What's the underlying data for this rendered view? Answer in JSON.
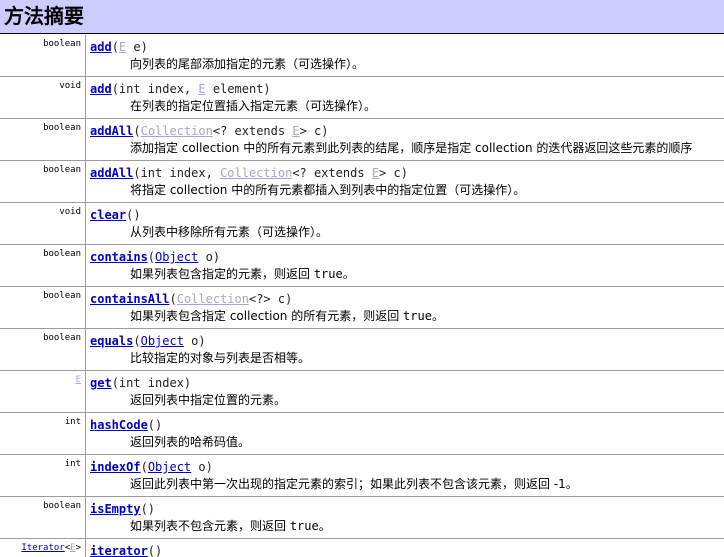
{
  "header": {
    "title": "方法摘要"
  },
  "rows": [
    {
      "ret": "boolean",
      "method": "add",
      "params": [
        {
          "text": "(",
          "kind": "plain"
        },
        {
          "text": "E",
          "kind": "type"
        },
        {
          "text": " e)",
          "kind": "plain"
        }
      ],
      "desc": "向列表的尾部添加指定的元素（可选操作）。"
    },
    {
      "ret": "void",
      "method": "add",
      "params": [
        {
          "text": "(int index, ",
          "kind": "plain"
        },
        {
          "text": "E",
          "kind": "type"
        },
        {
          "text": " element)",
          "kind": "plain"
        }
      ],
      "desc": "在列表的指定位置插入指定元素（可选操作）。"
    },
    {
      "ret": "boolean",
      "method": "addAll",
      "params": [
        {
          "text": "(",
          "kind": "plain"
        },
        {
          "text": "Collection",
          "kind": "type"
        },
        {
          "text": "<? extends ",
          "kind": "plain"
        },
        {
          "text": "E",
          "kind": "type"
        },
        {
          "text": "> c)",
          "kind": "plain"
        }
      ],
      "desc": "添加指定 collection 中的所有元素到此列表的结尾，顺序是指定 collection 的迭代器返回这些元素的顺序"
    },
    {
      "ret": "boolean",
      "method": "addAll",
      "params": [
        {
          "text": "(int index, ",
          "kind": "plain"
        },
        {
          "text": "Collection",
          "kind": "type"
        },
        {
          "text": "<? extends ",
          "kind": "plain"
        },
        {
          "text": "E",
          "kind": "type"
        },
        {
          "text": "> c)",
          "kind": "plain"
        }
      ],
      "desc": "将指定 collection 中的所有元素都插入到列表中的指定位置（可选操作）。"
    },
    {
      "ret": "void",
      "method": "clear",
      "params": [
        {
          "text": "()",
          "kind": "plain"
        }
      ],
      "desc": "从列表中移除所有元素（可选操作）。"
    },
    {
      "ret": "boolean",
      "method": "contains",
      "params": [
        {
          "text": "(",
          "kind": "plain"
        },
        {
          "text": "Object",
          "kind": "type-dark"
        },
        {
          "text": " o)",
          "kind": "plain"
        }
      ],
      "desc": "如果列表包含指定的元素，则返回 ",
      "desc_code": "true",
      "desc_tail": "。"
    },
    {
      "ret": "boolean",
      "method": "containsAll",
      "params": [
        {
          "text": "(",
          "kind": "plain"
        },
        {
          "text": "Collection",
          "kind": "type"
        },
        {
          "text": "<?> c)",
          "kind": "plain"
        }
      ],
      "desc": "如果列表包含指定 collection 的所有元素，则返回 ",
      "desc_code": "true",
      "desc_tail": "。"
    },
    {
      "ret": "boolean",
      "method": "equals",
      "params": [
        {
          "text": "(",
          "kind": "plain"
        },
        {
          "text": "Object",
          "kind": "type-dark"
        },
        {
          "text": " o)",
          "kind": "plain"
        }
      ],
      "desc": "比较指定的对象与列表是否相等。"
    },
    {
      "ret": "E",
      "ret_kind": "type",
      "method": "get",
      "params": [
        {
          "text": "(int index)",
          "kind": "plain"
        }
      ],
      "desc": "返回列表中指定位置的元素。"
    },
    {
      "ret": "int",
      "method": "hashCode",
      "params": [
        {
          "text": "()",
          "kind": "plain"
        }
      ],
      "desc": "返回列表的哈希码值。"
    },
    {
      "ret": "int",
      "method": "indexOf",
      "params": [
        {
          "text": "(",
          "kind": "plain"
        },
        {
          "text": "Object",
          "kind": "type-dark"
        },
        {
          "text": " o)",
          "kind": "plain"
        }
      ],
      "desc": "返回此列表中第一次出现的指定元素的索引；如果此列表不包含该元素，则返回 -1。"
    },
    {
      "ret": "boolean",
      "method": "isEmpty",
      "params": [
        {
          "text": "()",
          "kind": "plain"
        }
      ],
      "desc": "如果列表不包含元素，则返回 ",
      "desc_code": "true",
      "desc_tail": "。"
    },
    {
      "ret": "Iterator",
      "ret_kind": "type-dark",
      "ret_suffix": "<E>",
      "method": "iterator",
      "params": [
        {
          "text": "()",
          "kind": "plain"
        }
      ],
      "desc": ""
    }
  ]
}
